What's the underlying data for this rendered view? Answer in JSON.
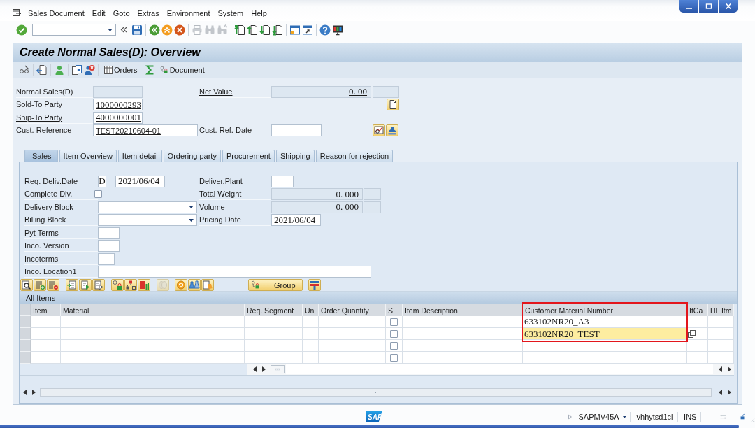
{
  "menu": [
    "Sales Document",
    "Edit",
    "Goto",
    "Extras",
    "Environment",
    "System",
    "Help"
  ],
  "screen": {
    "title": "Create Normal Sales(D): Overview",
    "toolbar_buttons": [
      "Orders",
      "Document"
    ]
  },
  "header": {
    "doc_type": {
      "label": "Normal Sales(D)",
      "underlined": false,
      "editable": false
    },
    "net_value": {
      "label": "Net Value",
      "underlined": true,
      "value": "0. 00",
      "editable": false
    },
    "sold_to_party": {
      "label": "Sold-To Party",
      "underlined": true,
      "value": "1000000293",
      "editable": true
    },
    "ship_to_party": {
      "label": "Ship-To Party",
      "underlined": true,
      "value": "4000000001",
      "editable": true
    },
    "cust_reference": {
      "label": "Cust. Reference",
      "underlined": true,
      "value": "TEST20210604-01",
      "editable": true
    },
    "cust_ref_date": {
      "label": "Cust. Ref. Date",
      "underlined": true,
      "editable": true
    }
  },
  "tabs": [
    {
      "label": "Sales",
      "selected": true
    },
    {
      "label": "Item Overview",
      "selected": false
    },
    {
      "label": "Item detail",
      "selected": false
    },
    {
      "label": "Ordering party",
      "selected": false
    },
    {
      "label": "Procurement",
      "selected": false
    },
    {
      "label": "Shipping",
      "selected": false
    },
    {
      "label": "Reason for rejection",
      "selected": false
    }
  ],
  "sales_tab": {
    "req_deliv_date": {
      "label": "Req. Deliv.Date",
      "format": "D",
      "value": "2021/06/04"
    },
    "complete_dlv": {
      "label": "Complete Dlv.",
      "checked": false
    },
    "delivery_block": {
      "label": "Delivery Block"
    },
    "billing_block": {
      "label": "Billing Block"
    },
    "pyt_terms": {
      "label": "Pyt Terms"
    },
    "inco_version": {
      "label": "Inco. Version"
    },
    "incoterms": {
      "label": "Incoterms"
    },
    "inco_location1": {
      "label": "Inco. Location1"
    },
    "deliver_plant": {
      "label": "Deliver.Plant"
    },
    "total_weight": {
      "label": "Total Weight",
      "value": "0. 000",
      "editable": false
    },
    "volume": {
      "label": "Volume",
      "value": "0. 000",
      "editable": false
    },
    "pricing_date": {
      "label": "Pricing Date",
      "value": "2021/06/04"
    }
  },
  "item_toolbar": {
    "group_button": "Group"
  },
  "items_table": {
    "title": "All Items",
    "columns": [
      {
        "label": "Item",
        "highlighted": false
      },
      {
        "label": "Material",
        "highlighted": false
      },
      {
        "label": "Req. Segment",
        "highlighted": false
      },
      {
        "label": "Un",
        "highlighted": false
      },
      {
        "label": "Order Quantity",
        "highlighted": false
      },
      {
        "label": "S",
        "highlighted": false
      },
      {
        "label": "Item Description",
        "highlighted": false
      },
      {
        "label": "Customer Material Number",
        "highlighted": true
      },
      {
        "label": "ItCa",
        "highlighted": false
      },
      {
        "label": "HL Itm",
        "highlighted": false
      }
    ],
    "rows": [
      {
        "selected": false,
        "s_checked": false,
        "customer_material_number": "633102NR20_A3",
        "focused": false
      },
      {
        "selected": false,
        "s_checked": false,
        "customer_material_number": "633102NR20_TEST",
        "focused": true
      },
      {
        "selected": false,
        "s_checked": false,
        "focused": false
      },
      {
        "selected": false,
        "s_checked": false,
        "focused": false
      }
    ]
  },
  "status_bar": {
    "logo": "SAP",
    "fields": [
      "SAPMV45A",
      "vhhytsd1cl",
      "INS"
    ]
  }
}
